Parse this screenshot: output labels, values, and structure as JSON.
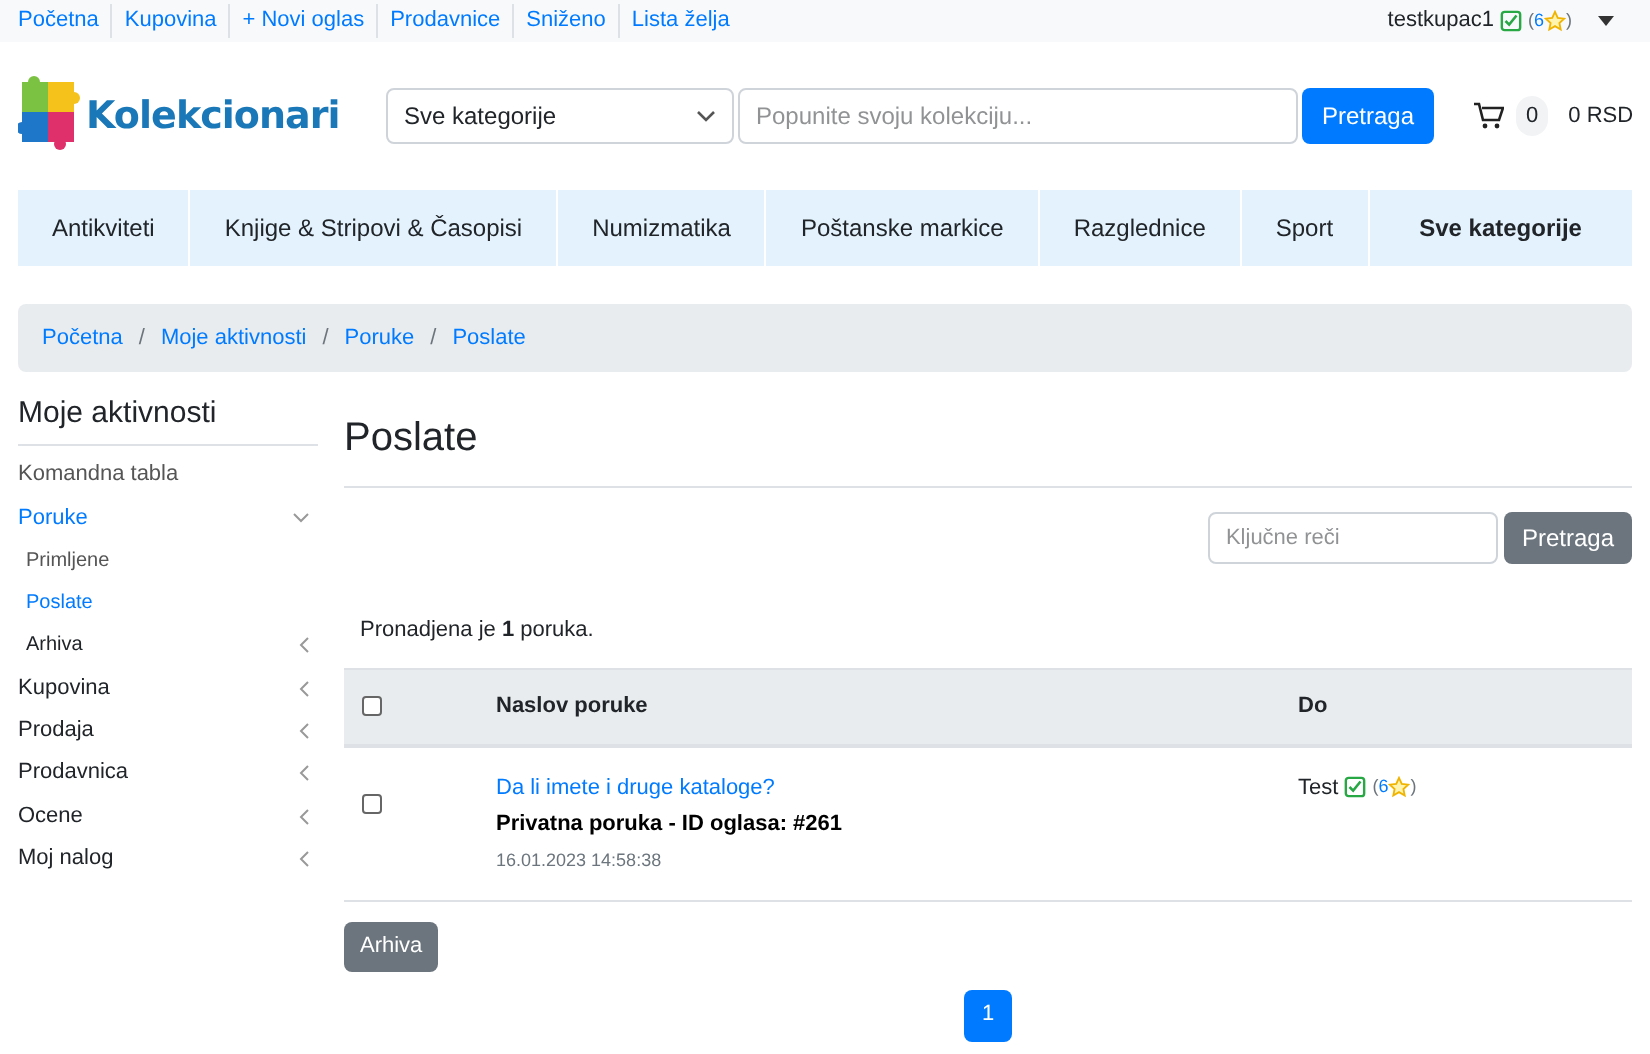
{
  "top_links": [
    "Početna",
    "Kupovina",
    "+ Novi oglas",
    "Prodavnice",
    "Sniženo",
    "Lista želja"
  ],
  "user": {
    "name": "testkupac1",
    "verified": true,
    "open": "(",
    "rating": "6",
    "close": ")"
  },
  "logo": "Kolekcionari",
  "category_select": {
    "value": "Sve kategorije"
  },
  "search": {
    "placeholder": "Popunite svoju kolekciju...",
    "button": "Pretraga"
  },
  "cart": {
    "count": "0",
    "total": "0 RSD"
  },
  "categories": [
    {
      "label": "Antikviteti",
      "bold": false
    },
    {
      "label": "Knjige & Stripovi & Časopisi",
      "bold": false
    },
    {
      "label": "Numizmatika",
      "bold": false
    },
    {
      "label": "Poštanske markice",
      "bold": false
    },
    {
      "label": "Razglednice",
      "bold": false
    },
    {
      "label": "Sport",
      "bold": false
    },
    {
      "label": "Sve kategorije",
      "bold": true
    }
  ],
  "breadcrumb": [
    "Početna",
    "Moje aktivnosti",
    "Poruke",
    "Poslate"
  ],
  "breadcrumb_separator": "/",
  "sidebar": {
    "title": "Moje aktivnosti",
    "items": [
      {
        "label": "Komandna tabla",
        "selected": false
      },
      {
        "label": "Poruke",
        "selected": true,
        "expanded": true,
        "children": [
          {
            "label": "Primljene",
            "selected": false
          },
          {
            "label": "Poslate",
            "selected": true
          },
          {
            "label": "Arhiva",
            "selected": false,
            "expanded": false
          }
        ]
      },
      {
        "label": "Kupovina",
        "selected": false,
        "expanded": false
      },
      {
        "label": "Prodaja",
        "selected": false,
        "expanded": false
      },
      {
        "label": "Prodavnica",
        "selected": false,
        "expanded": false
      },
      {
        "label": "Ocene",
        "selected": false,
        "expanded": false
      },
      {
        "label": "Moj nalog",
        "selected": false,
        "expanded": false
      }
    ]
  },
  "page_title": "Poslate",
  "keyword_search": {
    "placeholder": "Ključne reči",
    "button": "Pretraga"
  },
  "result_count": "Pronadjena je **1** poruka.",
  "table": {
    "columns": [
      "Naslov poruke",
      "Do"
    ],
    "all_checked": false,
    "rows": [
      {
        "checked": false,
        "subject": "Da li imete i druge kataloge?",
        "detail": "Privatna poruka - ID oglasa: #261",
        "date": "16.01.2023 14:58:38",
        "to": {
          "name": "Test",
          "verified": true,
          "open": "(",
          "rating": "6",
          "close": ")"
        }
      }
    ]
  },
  "archive_button": "Arhiva",
  "pagination": [
    {
      "label": "1",
      "selected": true
    }
  ]
}
